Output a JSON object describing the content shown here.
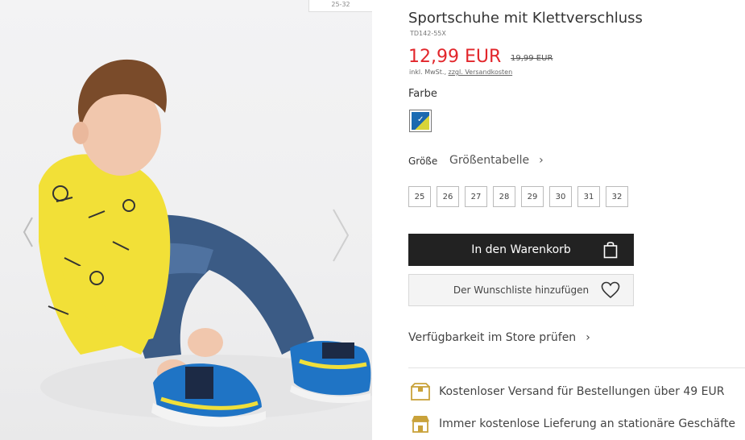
{
  "gallery": {
    "size_tag": "25-32"
  },
  "product": {
    "title": "Sportschuhe mit Klettverschluss",
    "sku": "TD142-55X",
    "price": "12,99 EUR",
    "old_price": "19,99 EUR",
    "tax_text": "inkl. MwSt.,",
    "shipping_link": "zzgl. Versandkosten"
  },
  "color": {
    "label": "Farbe",
    "selected_swatch": "blue-yellow",
    "check": "✓"
  },
  "size": {
    "label": "Größe",
    "table_link": "Größentabelle",
    "chevron": "›",
    "options": [
      "25",
      "26",
      "27",
      "28",
      "29",
      "30",
      "31",
      "32"
    ]
  },
  "actions": {
    "add_to_cart": "In den Warenkorb",
    "wishlist": "Der Wunschliste hinzufügen",
    "store_check": "Verfügbarkeit im Store prüfen",
    "chevron": "›"
  },
  "benefits": [
    {
      "icon": "box-icon",
      "text": "Kostenloser Versand für Bestellungen über 49 EUR"
    },
    {
      "icon": "store-icon",
      "text": "Immer kostenlose Lieferung an stationäre Geschäfte"
    }
  ],
  "colors": {
    "price_red": "#e2262b",
    "button_dark": "#222222",
    "icon_gold": "#c9a23a"
  }
}
